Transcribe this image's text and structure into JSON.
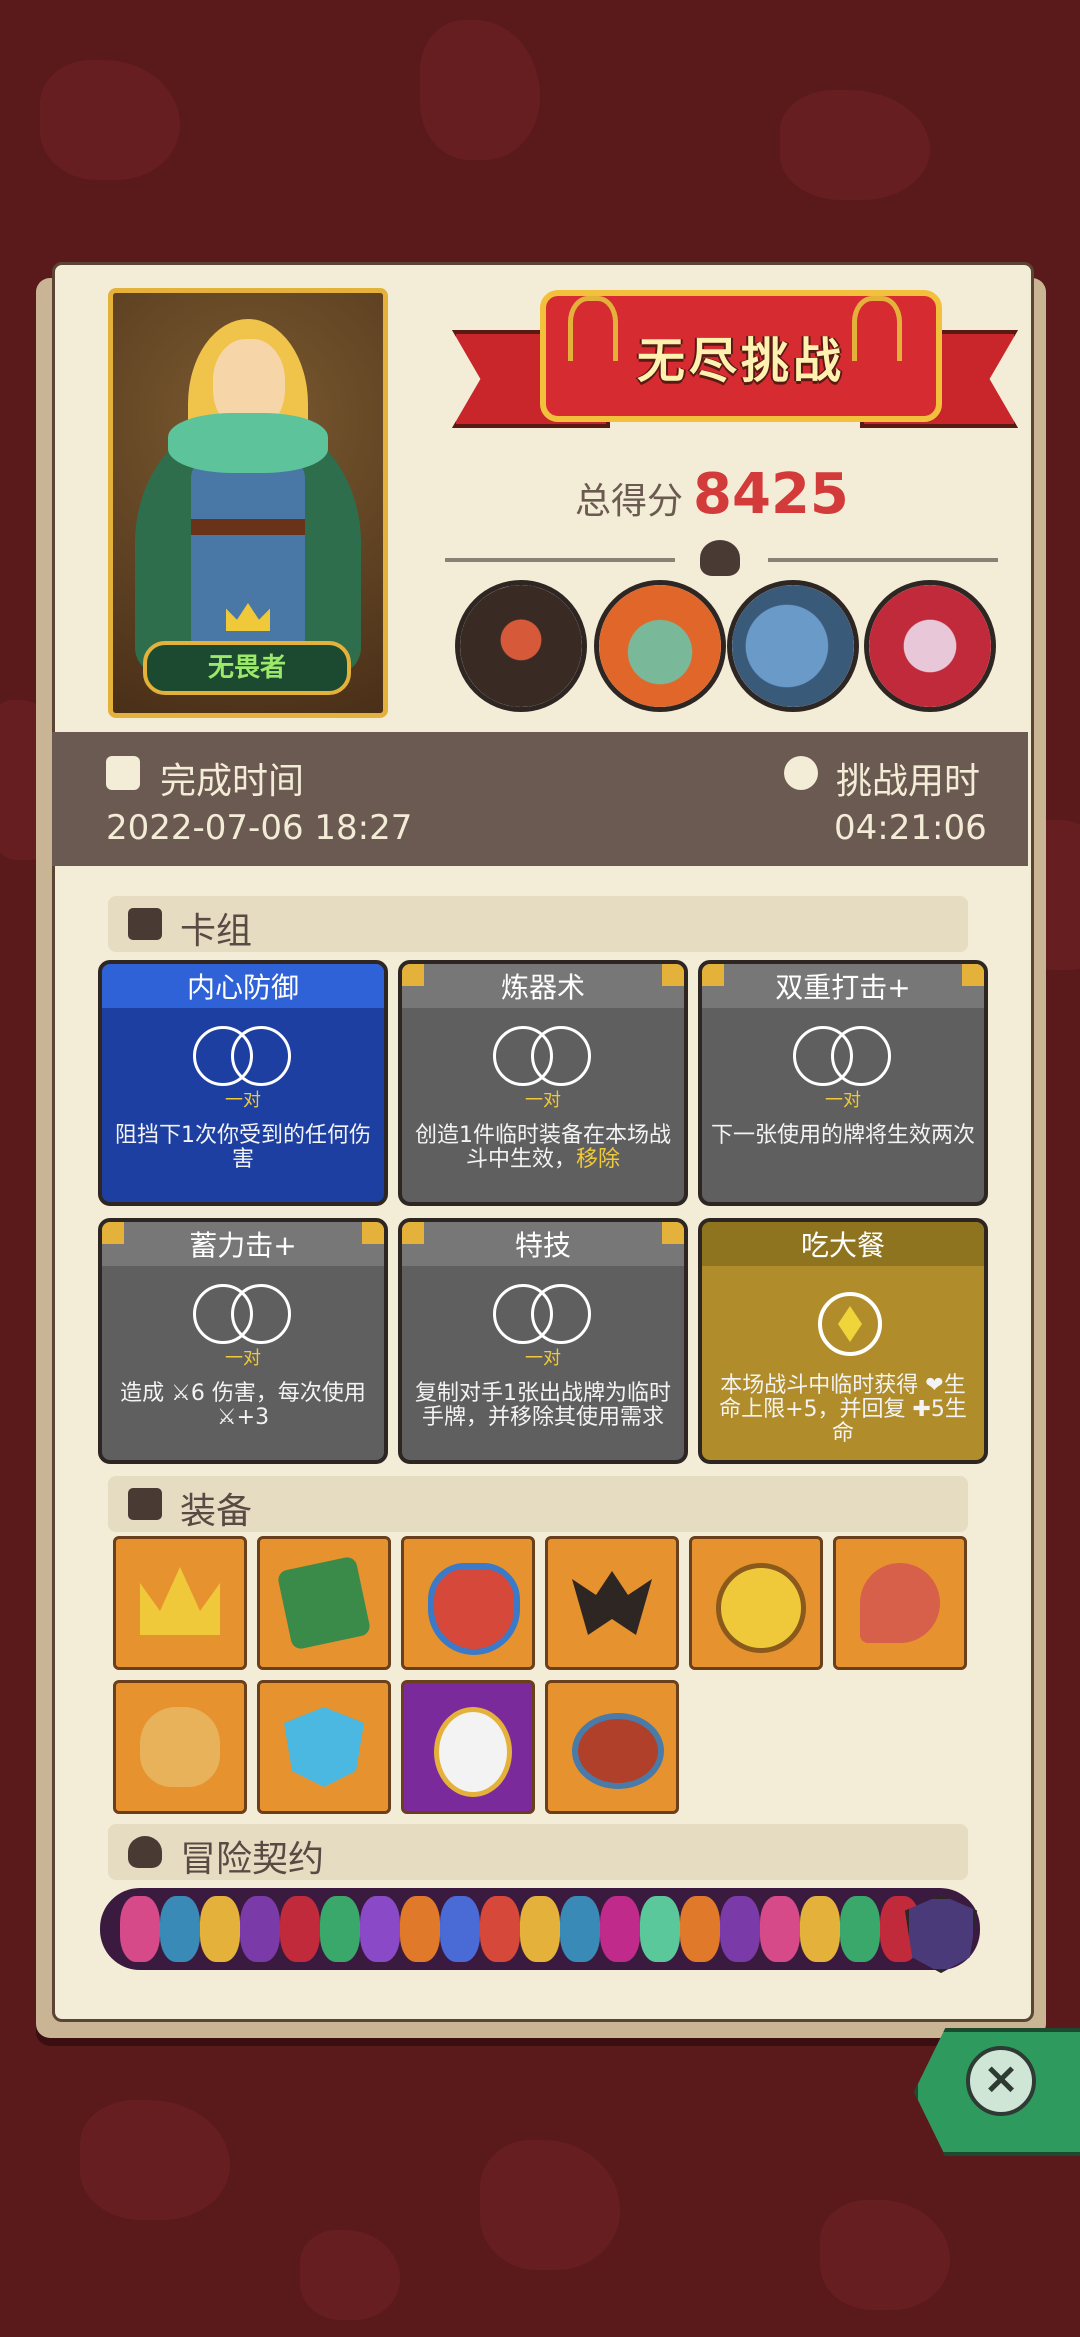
{
  "hero": {
    "label": "无畏者"
  },
  "banner": {
    "title": "无尽挑战"
  },
  "score": {
    "label": "总得分",
    "value": "8425"
  },
  "time": {
    "finish_label": "完成时间",
    "finish_value": "2022-07-06 18:27",
    "duration_label": "挑战用时",
    "duration_value": "04:21:06"
  },
  "sections": {
    "deck": "卡组",
    "equipment": "装备",
    "contracts": "冒险契约"
  },
  "pair_label": "一对",
  "cards": [
    {
      "title": "内心防御",
      "desc": "阻挡下1次你受到的任何伤害",
      "desc_hl": "",
      "style": "blue"
    },
    {
      "title": "炼器术",
      "desc": "创造1件临时装备在本场战斗中生效，",
      "desc_hl": "移除",
      "style": "gray"
    },
    {
      "title": "双重打击+",
      "desc": "下一张使用的牌将生效两次",
      "desc_hl": "",
      "style": "gray"
    },
    {
      "title": "蓄力击+",
      "desc": "造成 ⚔6 伤害，每次使用 ⚔+3",
      "desc_hl": "",
      "style": "gray"
    },
    {
      "title": "特技",
      "desc": "复制对手1张出战牌为临时手牌，并移除其使用需求",
      "desc_hl": "",
      "style": "gray"
    },
    {
      "title": "吃大餐",
      "desc": "本场战斗中临时获得 ❤生命上限+5，并回复 ✚5生命",
      "desc_hl": "",
      "style": "gold"
    }
  ],
  "equipment": [
    {
      "icon": "crown-icon"
    },
    {
      "icon": "spellbook-icon"
    },
    {
      "icon": "mask-icon"
    },
    {
      "icon": "bat-wings-icon"
    },
    {
      "icon": "coin-icon"
    },
    {
      "icon": "meat-icon"
    },
    {
      "icon": "money-bag-icon"
    },
    {
      "icon": "shield-icon"
    },
    {
      "icon": "mirror-icon"
    },
    {
      "icon": "bowl-icon"
    }
  ],
  "colors": {
    "background": "#5a1a1c",
    "paper": "#f3ecd6",
    "score": "#d33a3a",
    "equip_tile": "#e6922e",
    "close_tab": "#2f9a5e"
  }
}
